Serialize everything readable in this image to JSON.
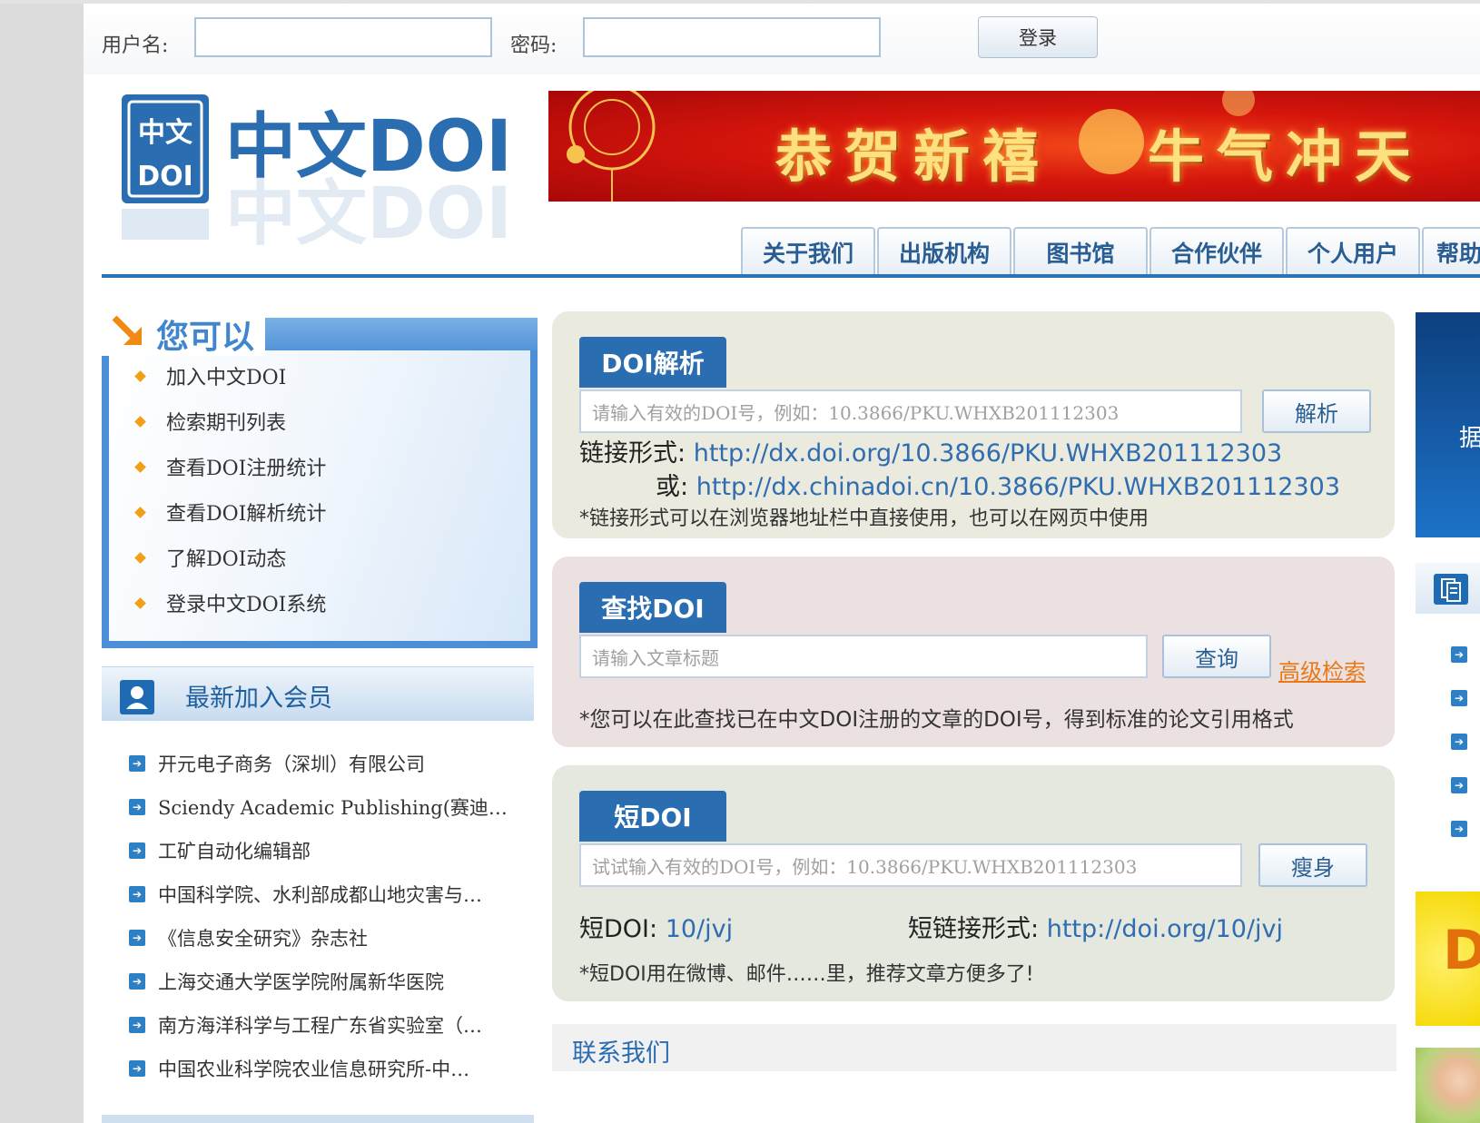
{
  "login": {
    "username_label": "用户名:",
    "password_label": "密码:",
    "username_value": "",
    "password_value": "",
    "login_button": "登录"
  },
  "logo": {
    "text": "中文DOI",
    "seal_text": "中文DOI"
  },
  "banner": {
    "left_text": "恭贺新禧",
    "right_text": "牛气冲天"
  },
  "nav": {
    "tabs": [
      "关于我们",
      "出版机构",
      "图书馆",
      "合作伙伴",
      "个人用户",
      "帮助"
    ]
  },
  "you_can": {
    "title": "您可以",
    "items": [
      "加入中文DOI",
      "检索期刊列表",
      "查看DOI注册统计",
      "查看DOI解析统计",
      "了解DOI动态",
      "登录中文DOI系统"
    ]
  },
  "members": {
    "title": "最新加入会员",
    "items": [
      "开元电子商务（深圳）有限公司",
      "Sciendy Academic Publishing(赛迪…",
      "工矿自动化编辑部",
      "中国科学院、水利部成都山地灾害与…",
      "《信息安全研究》杂志社",
      "上海交通大学医学院附属新华医院",
      "南方海洋科学与工程广东省实验室（…",
      "中国农业科学院农业信息研究所-中…"
    ]
  },
  "resolve": {
    "tab": "DOI解析",
    "placeholder": "请输入有效的DOI号，例如：10.3866/PKU.WHXB201112303",
    "button": "解析",
    "link_label": "链接形式:",
    "link_url": "http://dx.doi.org/10.3866/PKU.WHXB201112303",
    "or_label": "或:",
    "or_url": "http://dx.chinadoi.cn/10.3866/PKU.WHXB201112303",
    "note": "*链接形式可以在浏览器地址栏中直接使用，也可以在网页中使用"
  },
  "find": {
    "tab": "查找DOI",
    "placeholder": "请输入文章标题",
    "button": "查询",
    "advanced": "高级检索",
    "note": "*您可以在此查找已在中文DOI注册的文章的DOI号，得到标准的论文引用格式"
  },
  "short": {
    "tab": "短DOI",
    "placeholder": "试试输入有效的DOI号，例如：10.3866/PKU.WHXB201112303",
    "button": "瘦身",
    "short_label": "短DOI:",
    "short_value": "10/jvj",
    "link_label": "短链接形式:",
    "link_url": "http://doi.org/10/jvj",
    "note": "*短DOI用在微博、邮件……里，推荐文章方便多了!"
  },
  "contact": {
    "title": "联系我们"
  },
  "right": {
    "blue_text": "据",
    "yellow_text": "D"
  },
  "colors": {
    "brand_blue": "#2a6db1",
    "resolve_bg": "#ebeade",
    "find_bg": "#ebe1e1",
    "short_bg": "#e4e8df",
    "accent_orange": "#e8791a"
  }
}
